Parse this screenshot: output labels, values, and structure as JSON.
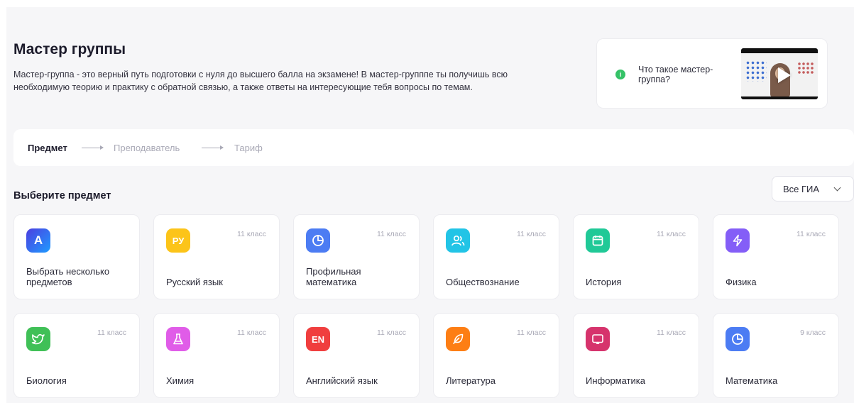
{
  "header": {
    "title": "Мастер группы",
    "description": "Мастер-группа - это верный путь подготовки с нуля до высшего балла на экзамене! В мастер-групппе ты получишь всю необходимую теорию и практику с обратной связью, а также ответы на интересующие тебя вопросы по темам."
  },
  "video": {
    "label": "Что такое мастер-группа?"
  },
  "steps": [
    "Предмет",
    "Преподаватель",
    "Тариф"
  ],
  "section": {
    "title": "Выберите предмет"
  },
  "filter": {
    "selected": "Все ГИА"
  },
  "subjects": [
    {
      "name": "Выбрать несколько предметов",
      "grade": "",
      "icon": "multi-select-icon",
      "color": "#3b5bdb"
    },
    {
      "name": "Русский язык",
      "grade": "11 класс",
      "icon": "ru-letters-icon",
      "color": "#fcc419"
    },
    {
      "name": "Профильная математика",
      "grade": "11 класс",
      "icon": "pie-chart-icon",
      "color": "#4c7cf3"
    },
    {
      "name": "Обществознание",
      "grade": "11 класс",
      "icon": "people-icon",
      "color": "#22c4e6"
    },
    {
      "name": "История",
      "grade": "11 класс",
      "icon": "calendar-icon",
      "color": "#20c997"
    },
    {
      "name": "Физика",
      "grade": "11 класс",
      "icon": "lightning-icon",
      "color": "#845ef7"
    },
    {
      "name": "Биология",
      "grade": "11 класс",
      "icon": "bird-icon",
      "color": "#40c057"
    },
    {
      "name": "Химия",
      "grade": "11 класс",
      "icon": "flask-icon",
      "color": "#e05ce8"
    },
    {
      "name": "Английский язык",
      "grade": "11 класс",
      "icon": "en-letters-icon",
      "color": "#f03e3e"
    },
    {
      "name": "Литература",
      "grade": "11 класс",
      "icon": "feather-icon",
      "color": "#fd7e14"
    },
    {
      "name": "Информатика",
      "grade": "11 класс",
      "icon": "monitor-icon",
      "color": "#d6336c"
    },
    {
      "name": "Математика",
      "grade": "9 класс",
      "icon": "pie-chart-icon",
      "color": "#4c7cf3"
    }
  ],
  "icon_text": {
    "ru": "РУ",
    "en": "EN",
    "multi": "А"
  }
}
